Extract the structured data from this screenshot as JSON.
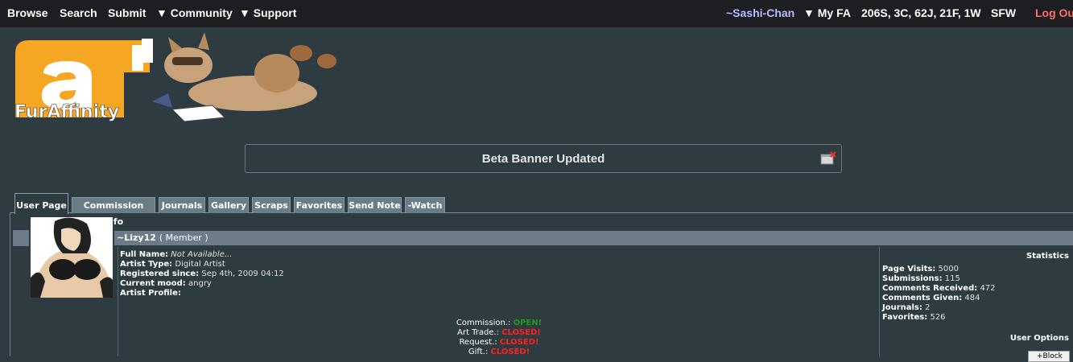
{
  "topnav": {
    "browse": "Browse",
    "search": "Search",
    "submit": "Submit",
    "community": "▼ Community",
    "support": "▼ Support",
    "user": "~Sashi-Chan",
    "myfa": "▼ My FA",
    "notifications": "206S, 3C, 62J, 21F, 1W",
    "sfw": "SFW",
    "logout": "Log Out"
  },
  "logo": {
    "text": "FurAffinity"
  },
  "notice": {
    "text": "Beta Banner Updated"
  },
  "tabs": [
    "User Page",
    "Commission Info",
    "Journals",
    "Gallery",
    "Scraps",
    "Favorites",
    "Send Note",
    "-Watch"
  ],
  "profile": {
    "username": "~Lizy12",
    "role": "( Member )",
    "full_name_label": "Full Name:",
    "full_name": "Not Available...",
    "artist_type_label": "Artist Type:",
    "artist_type": "Digital Artist",
    "registered_label": "Registered since:",
    "registered": "Sep 4th, 2009 04:12",
    "mood_label": "Current mood:",
    "mood": "angry",
    "artist_profile_label": "Artist Profile:"
  },
  "status": [
    {
      "label": "Commission.:",
      "value": "OPEN!",
      "state": "open"
    },
    {
      "label": "Art Trade.:",
      "value": "CLOSED!",
      "state": "closed"
    },
    {
      "label": "Request.:",
      "value": "CLOSED!",
      "state": "closed"
    },
    {
      "label": "Gift.:",
      "value": "CLOSED!",
      "state": "closed"
    }
  ],
  "statistics": {
    "title": "Statistics",
    "page_visits_label": "Page Visits:",
    "page_visits": "5000",
    "submissions_label": "Submissions:",
    "submissions": "115",
    "comments_received_label": "Comments Received:",
    "comments_received": "472",
    "comments_given_label": "Comments Given:",
    "comments_given": "484",
    "journals_label": "Journals:",
    "journals": "2",
    "favorites_label": "Favorites:",
    "favorites": "526"
  },
  "user_options": {
    "title": "User Options",
    "block": "+Block"
  },
  "colors": {
    "nav_bg": "#1c1e21",
    "page_bg": "#2e3b41",
    "username": "#b9b9ff",
    "logout": "#ff6b6b",
    "open": "#1f9a1f",
    "closed": "#ff2020",
    "logo_orange": "#f5a623"
  }
}
